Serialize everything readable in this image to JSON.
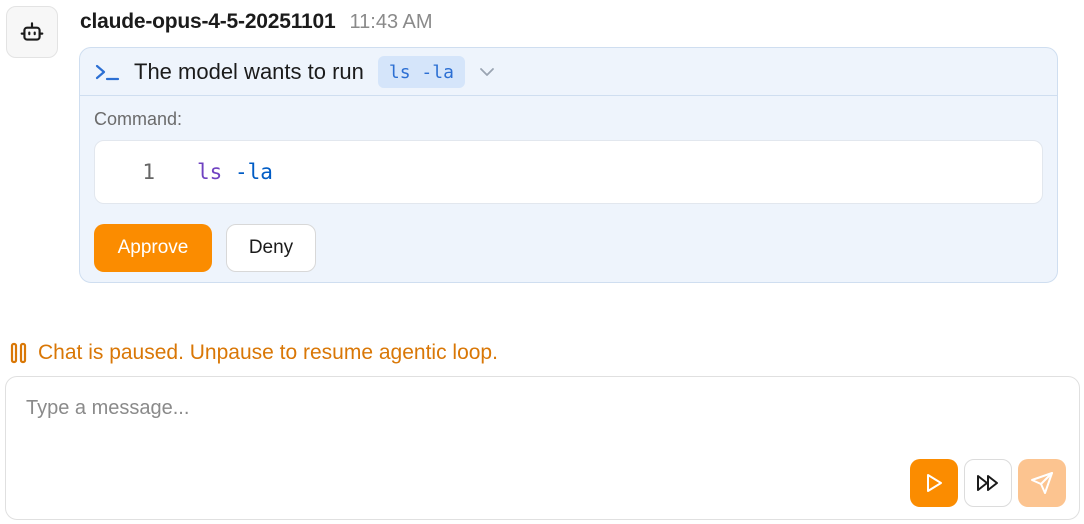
{
  "message": {
    "author": "claude-opus-4-5-20251101",
    "time": "11:43 AM",
    "avatar_icon": "robot-icon"
  },
  "tool_request": {
    "title": "The model wants to run",
    "command_chip": "ls -la",
    "command_label": "Command:",
    "code_lines": [
      {
        "number": "1",
        "command": "ls",
        "args": "-la"
      }
    ],
    "approve_label": "Approve",
    "deny_label": "Deny",
    "colors": {
      "accent": "#fb8c00",
      "card_bg": "#eef4fc",
      "chip_text": "#2c6fd3"
    }
  },
  "status": {
    "text": "Chat is paused. Unpause to resume agentic loop.",
    "icon": "pause-icon",
    "color": "#d97706"
  },
  "composer": {
    "placeholder": "Type a message...",
    "buttons": [
      "play-icon",
      "fast-forward-icon",
      "send-icon"
    ]
  }
}
